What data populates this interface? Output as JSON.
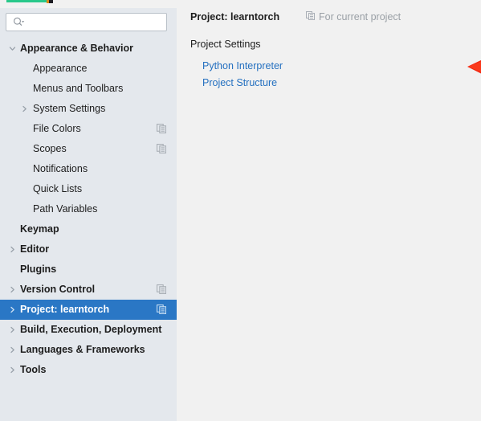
{
  "window": {
    "top_strip": {
      "green_bar_color": "#29c88a",
      "dark_mark_color": "#1b1b22"
    }
  },
  "colors": {
    "sidebar_bg": "#e4e8ed",
    "main_bg": "#f1f1f1",
    "selection_blue": "#2a77c5",
    "link_blue": "#2470c0",
    "muted_gray": "#9aa0a6",
    "annotation_red": "#f22711"
  },
  "sidebar": {
    "search": {
      "value": "",
      "placeholder": "",
      "icon": "search-icon",
      "dropdown_icon": "chevron-down-icon"
    },
    "items": [
      {
        "label": "Appearance & Behavior",
        "level": 0,
        "bold": true,
        "chevron": "chevron-down-icon",
        "selected": false,
        "icon": null
      },
      {
        "label": "Appearance",
        "level": 1,
        "bold": false,
        "chevron": null,
        "selected": false,
        "icon": null
      },
      {
        "label": "Menus and Toolbars",
        "level": 1,
        "bold": false,
        "chevron": null,
        "selected": false,
        "icon": null
      },
      {
        "label": "System Settings",
        "level": 1,
        "bold": false,
        "chevron": "chevron-right-icon",
        "selected": false,
        "icon": null
      },
      {
        "label": "File Colors",
        "level": 1,
        "bold": false,
        "chevron": null,
        "selected": false,
        "icon": "copy-pages-icon"
      },
      {
        "label": "Scopes",
        "level": 1,
        "bold": false,
        "chevron": null,
        "selected": false,
        "icon": "copy-pages-icon"
      },
      {
        "label": "Notifications",
        "level": 1,
        "bold": false,
        "chevron": null,
        "selected": false,
        "icon": null
      },
      {
        "label": "Quick Lists",
        "level": 1,
        "bold": false,
        "chevron": null,
        "selected": false,
        "icon": null
      },
      {
        "label": "Path Variables",
        "level": 1,
        "bold": false,
        "chevron": null,
        "selected": false,
        "icon": null
      },
      {
        "label": "Keymap",
        "level": 0,
        "bold": true,
        "chevron": null,
        "selected": false,
        "icon": null
      },
      {
        "label": "Editor",
        "level": 0,
        "bold": true,
        "chevron": "chevron-right-icon",
        "selected": false,
        "icon": null
      },
      {
        "label": "Plugins",
        "level": 0,
        "bold": true,
        "chevron": null,
        "selected": false,
        "icon": null
      },
      {
        "label": "Version Control",
        "level": 0,
        "bold": true,
        "chevron": "chevron-right-icon",
        "selected": false,
        "icon": "copy-pages-icon"
      },
      {
        "label": "Project: learntorch",
        "level": 0,
        "bold": true,
        "chevron": "chevron-right-icon",
        "selected": true,
        "icon": "copy-pages-icon"
      },
      {
        "label": "Build, Execution, Deployment",
        "level": 0,
        "bold": true,
        "chevron": "chevron-right-icon",
        "selected": false,
        "icon": null
      },
      {
        "label": "Languages & Frameworks",
        "level": 0,
        "bold": true,
        "chevron": "chevron-right-icon",
        "selected": false,
        "icon": null
      },
      {
        "label": "Tools",
        "level": 0,
        "bold": true,
        "chevron": "chevron-right-icon",
        "selected": false,
        "icon": null
      }
    ]
  },
  "main": {
    "title": "Project: learntorch",
    "for_current_project": {
      "label": "For current project",
      "icon": "copy-pages-icon"
    },
    "section_label": "Project Settings",
    "links": [
      {
        "label": "Python Interpreter"
      },
      {
        "label": "Project Structure"
      }
    ]
  },
  "annotation": {
    "arrow": {
      "type": "arrow-left",
      "color": "#f22711",
      "points_at": "Python Interpreter"
    }
  }
}
